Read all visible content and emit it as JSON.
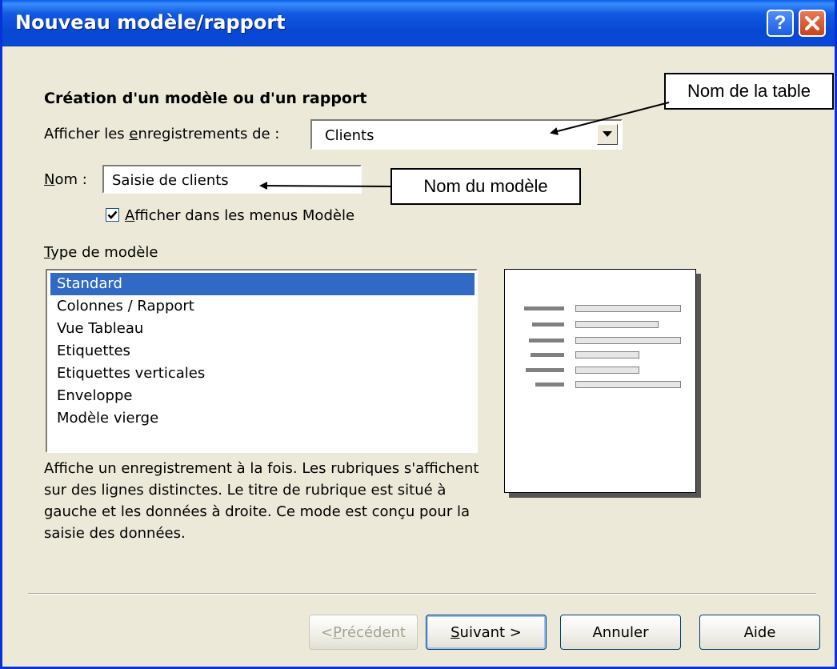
{
  "window": {
    "title": "Nouveau modèle/rapport",
    "help_glyph": "?",
    "close_glyph": "✕"
  },
  "form": {
    "heading": "Création d'un modèle ou d'un rapport",
    "records_label_pre": "Afficher les ",
    "records_label_accel": "e",
    "records_label_post": "nregistrements de :",
    "records_value": "Clients",
    "name_label_accel": "N",
    "name_label_post": "om :",
    "name_value": "Saisie de clients",
    "menu_checkbox_checked": true,
    "menu_checkbox_accel": "A",
    "menu_checkbox_post": "fficher dans les menus Modèle",
    "type_label_accel": "T",
    "type_label_post": "ype de modèle",
    "types": [
      "Standard",
      "Colonnes / Rapport",
      "Vue Tableau",
      "Etiquettes",
      "Etiquettes verticales",
      "Enveloppe",
      "Modèle vierge"
    ],
    "selected_type": "Standard",
    "description": "Affiche un enregistrement à la fois. Les rubriques s'affichent sur des lignes distinctes. Le titre de rubrique est situé à gauche et les données à droite. Ce mode est conçu pour la saisie des données."
  },
  "buttons": {
    "previous_pre": "< ",
    "previous_accel": "P",
    "previous_post": "récédent",
    "next_accel": "S",
    "next_post": "uivant >",
    "cancel": "Annuler",
    "help": "Aide"
  },
  "annotations": {
    "table_name": "Nom de la table",
    "model_name": "Nom du modèle"
  }
}
